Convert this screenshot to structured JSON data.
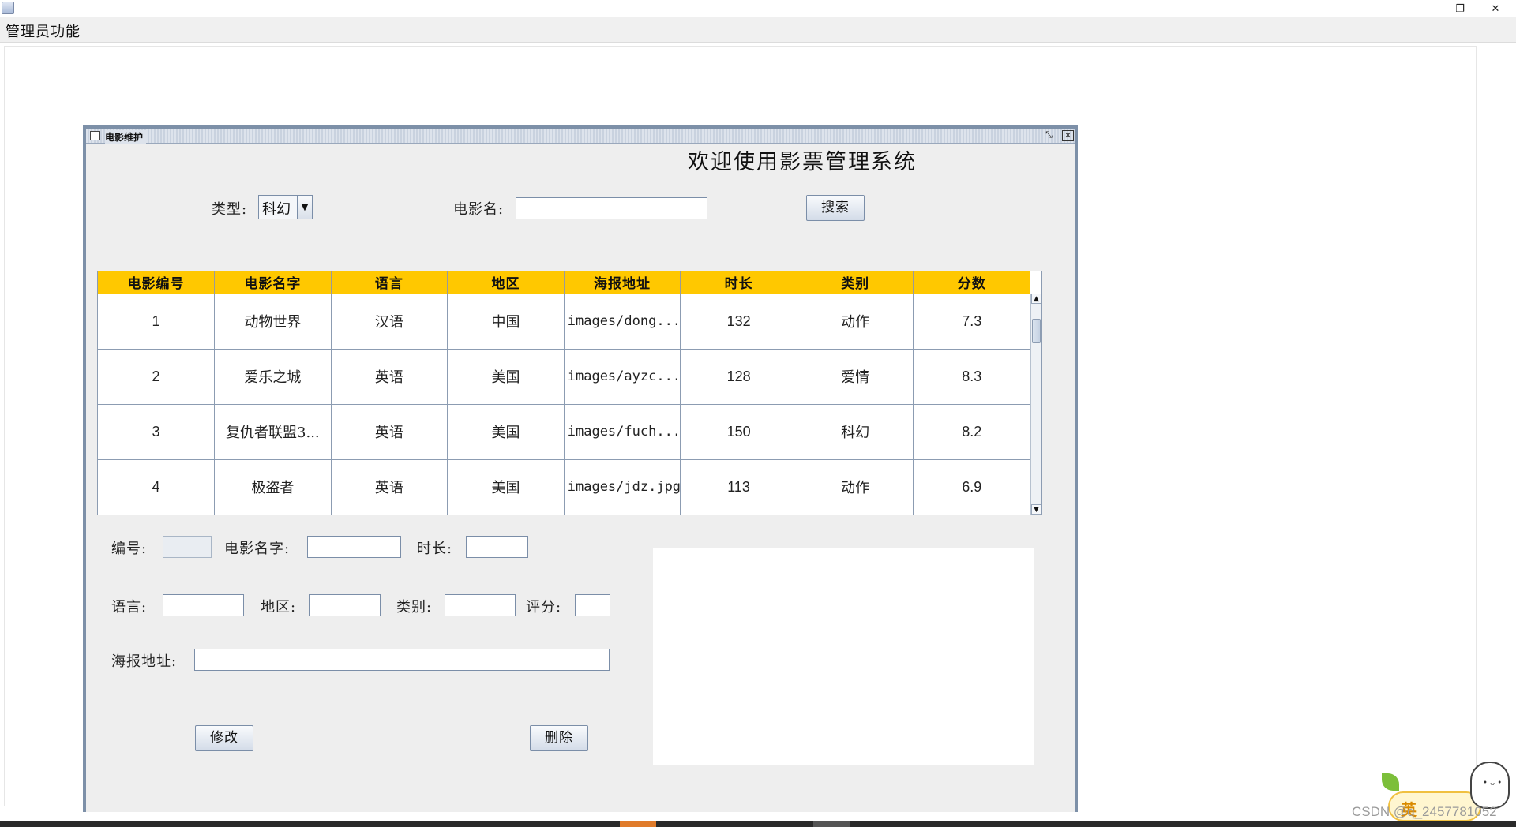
{
  "window": {
    "menu": "管理员功能",
    "controls": {
      "minimize": "—",
      "restore": "❐",
      "close": "✕"
    }
  },
  "internal_frame": {
    "title": "电影维护",
    "welcome": "欢迎使用影票管理系统",
    "search": {
      "type_label": "类型:",
      "type_value": "科幻",
      "name_label": "电影名:",
      "name_value": "",
      "search_button": "搜索"
    },
    "table": {
      "columns": [
        "电影编号",
        "电影名字",
        "语言",
        "地区",
        "海报地址",
        "时长",
        "类别",
        "分数"
      ],
      "rows": [
        [
          "1",
          "动物世界",
          "汉语",
          "中国",
          "images/dong...",
          "132",
          "动作",
          "7.3"
        ],
        [
          "2",
          "爱乐之城",
          "英语",
          "美国",
          "images/ayzc...",
          "128",
          "爱情",
          "8.3"
        ],
        [
          "3",
          "复仇者联盟3...",
          "英语",
          "美国",
          "images/fuch...",
          "150",
          "科幻",
          "8.2"
        ],
        [
          "4",
          "极盗者",
          "英语",
          "美国",
          "images/jdz.jpg",
          "113",
          "动作",
          "6.9"
        ]
      ]
    },
    "form": {
      "id_label": "编号:",
      "name_label": "电影名字:",
      "duration_label": "时长:",
      "language_label": "语言:",
      "region_label": "地区:",
      "category_label": "类别:",
      "score_label": "评分:",
      "poster_label": "海报地址:",
      "modify_button": "修改",
      "delete_button": "删除"
    }
  },
  "overlay": {
    "watermark": "CSDN @q_2457781052",
    "ime_label": "英"
  }
}
